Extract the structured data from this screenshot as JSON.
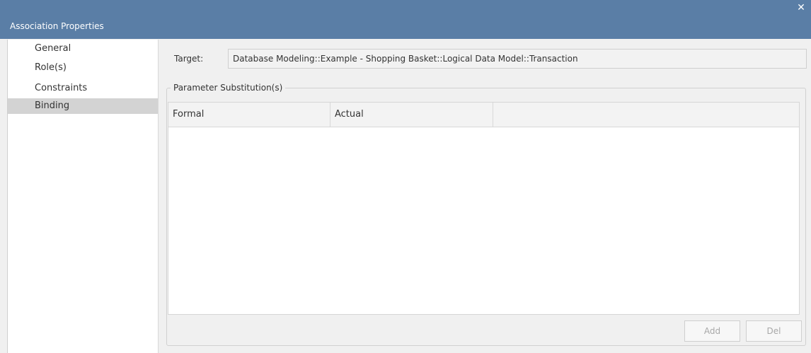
{
  "window": {
    "title": "Association Properties",
    "close_glyph": "✕"
  },
  "sidebar": {
    "items": [
      {
        "label": "General",
        "selected": false
      },
      {
        "label": "Role(s)",
        "selected": false
      },
      {
        "label": "Constraints",
        "selected": false
      },
      {
        "label": "Binding",
        "selected": true
      }
    ]
  },
  "binding": {
    "target_label": "Target:",
    "target_value": "Database Modeling::Example - Shopping Basket::Logical Data Model::Transaction",
    "group_label": "Parameter Substitution(s)",
    "columns": [
      "Formal",
      "Actual"
    ],
    "rows": [],
    "add_label": "Add",
    "del_label": "Del",
    "buttons_enabled": false
  },
  "colors": {
    "titlebar": "#5a7ea6",
    "selected_item": "#d3d3d3"
  }
}
